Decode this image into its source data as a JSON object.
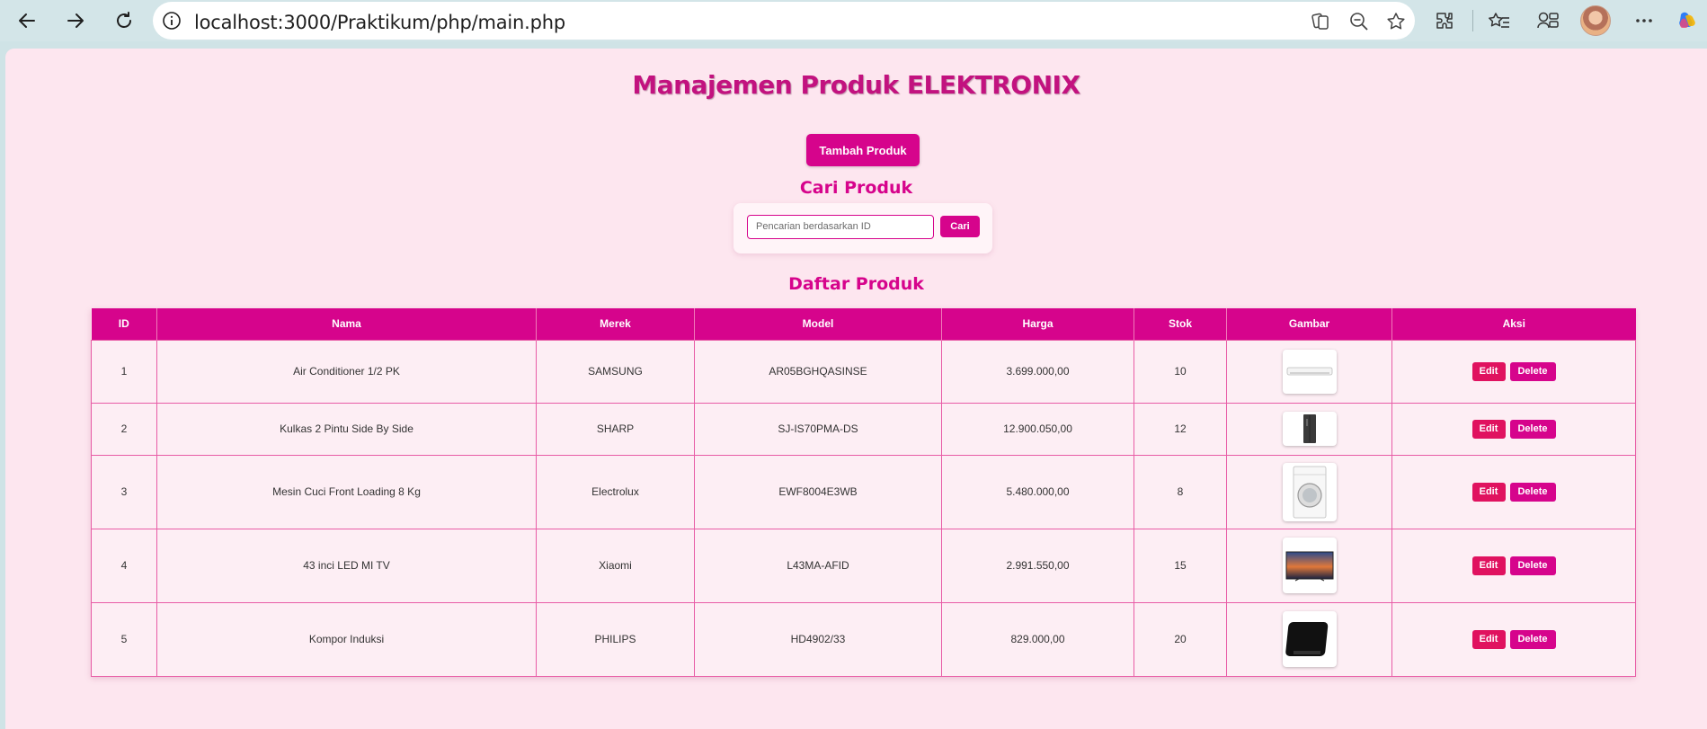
{
  "browser": {
    "url": "localhost:3000/Praktikum/php/main.php"
  },
  "page": {
    "title": "Manajemen Produk ELEKTRONIX",
    "add_button": "Tambah Produk",
    "search_heading": "Cari Produk",
    "search_placeholder": "Pencarian berdasarkan ID",
    "search_button": "Cari",
    "list_heading": "Daftar Produk"
  },
  "table": {
    "headers": [
      "ID",
      "Nama",
      "Merek",
      "Model",
      "Harga",
      "Stok",
      "Gambar",
      "Aksi"
    ],
    "rows": [
      {
        "id": "1",
        "nama": "Air Conditioner 1/2 PK",
        "merek": "SAMSUNG",
        "model": "AR05BGHQASINSE",
        "harga": "3.699.000,00",
        "stok": "10",
        "gambar": "air-conditioner-image"
      },
      {
        "id": "2",
        "nama": "Kulkas 2 Pintu Side By Side",
        "merek": "SHARP",
        "model": "SJ-IS70PMA-DS",
        "harga": "12.900.050,00",
        "stok": "12",
        "gambar": "refrigerator-image"
      },
      {
        "id": "3",
        "nama": "Mesin Cuci Front Loading 8 Kg",
        "merek": "Electrolux",
        "model": "EWF8004E3WB",
        "harga": "5.480.000,00",
        "stok": "8",
        "gambar": "washing-machine-image"
      },
      {
        "id": "4",
        "nama": "43 inci LED MI TV",
        "merek": "Xiaomi",
        "model": "L43MA-AFID",
        "harga": "2.991.550,00",
        "stok": "15",
        "gambar": "tv-image"
      },
      {
        "id": "5",
        "nama": "Kompor Induksi",
        "merek": "PHILIPS",
        "model": "HD4902/33",
        "harga": "829.000,00",
        "stok": "20",
        "gambar": "induction-cooker-image"
      }
    ],
    "edit_label": "Edit",
    "delete_label": "Delete"
  },
  "colors": {
    "accent": "#d6048c",
    "edit": "#e0125f",
    "background": "#fde6ef"
  }
}
